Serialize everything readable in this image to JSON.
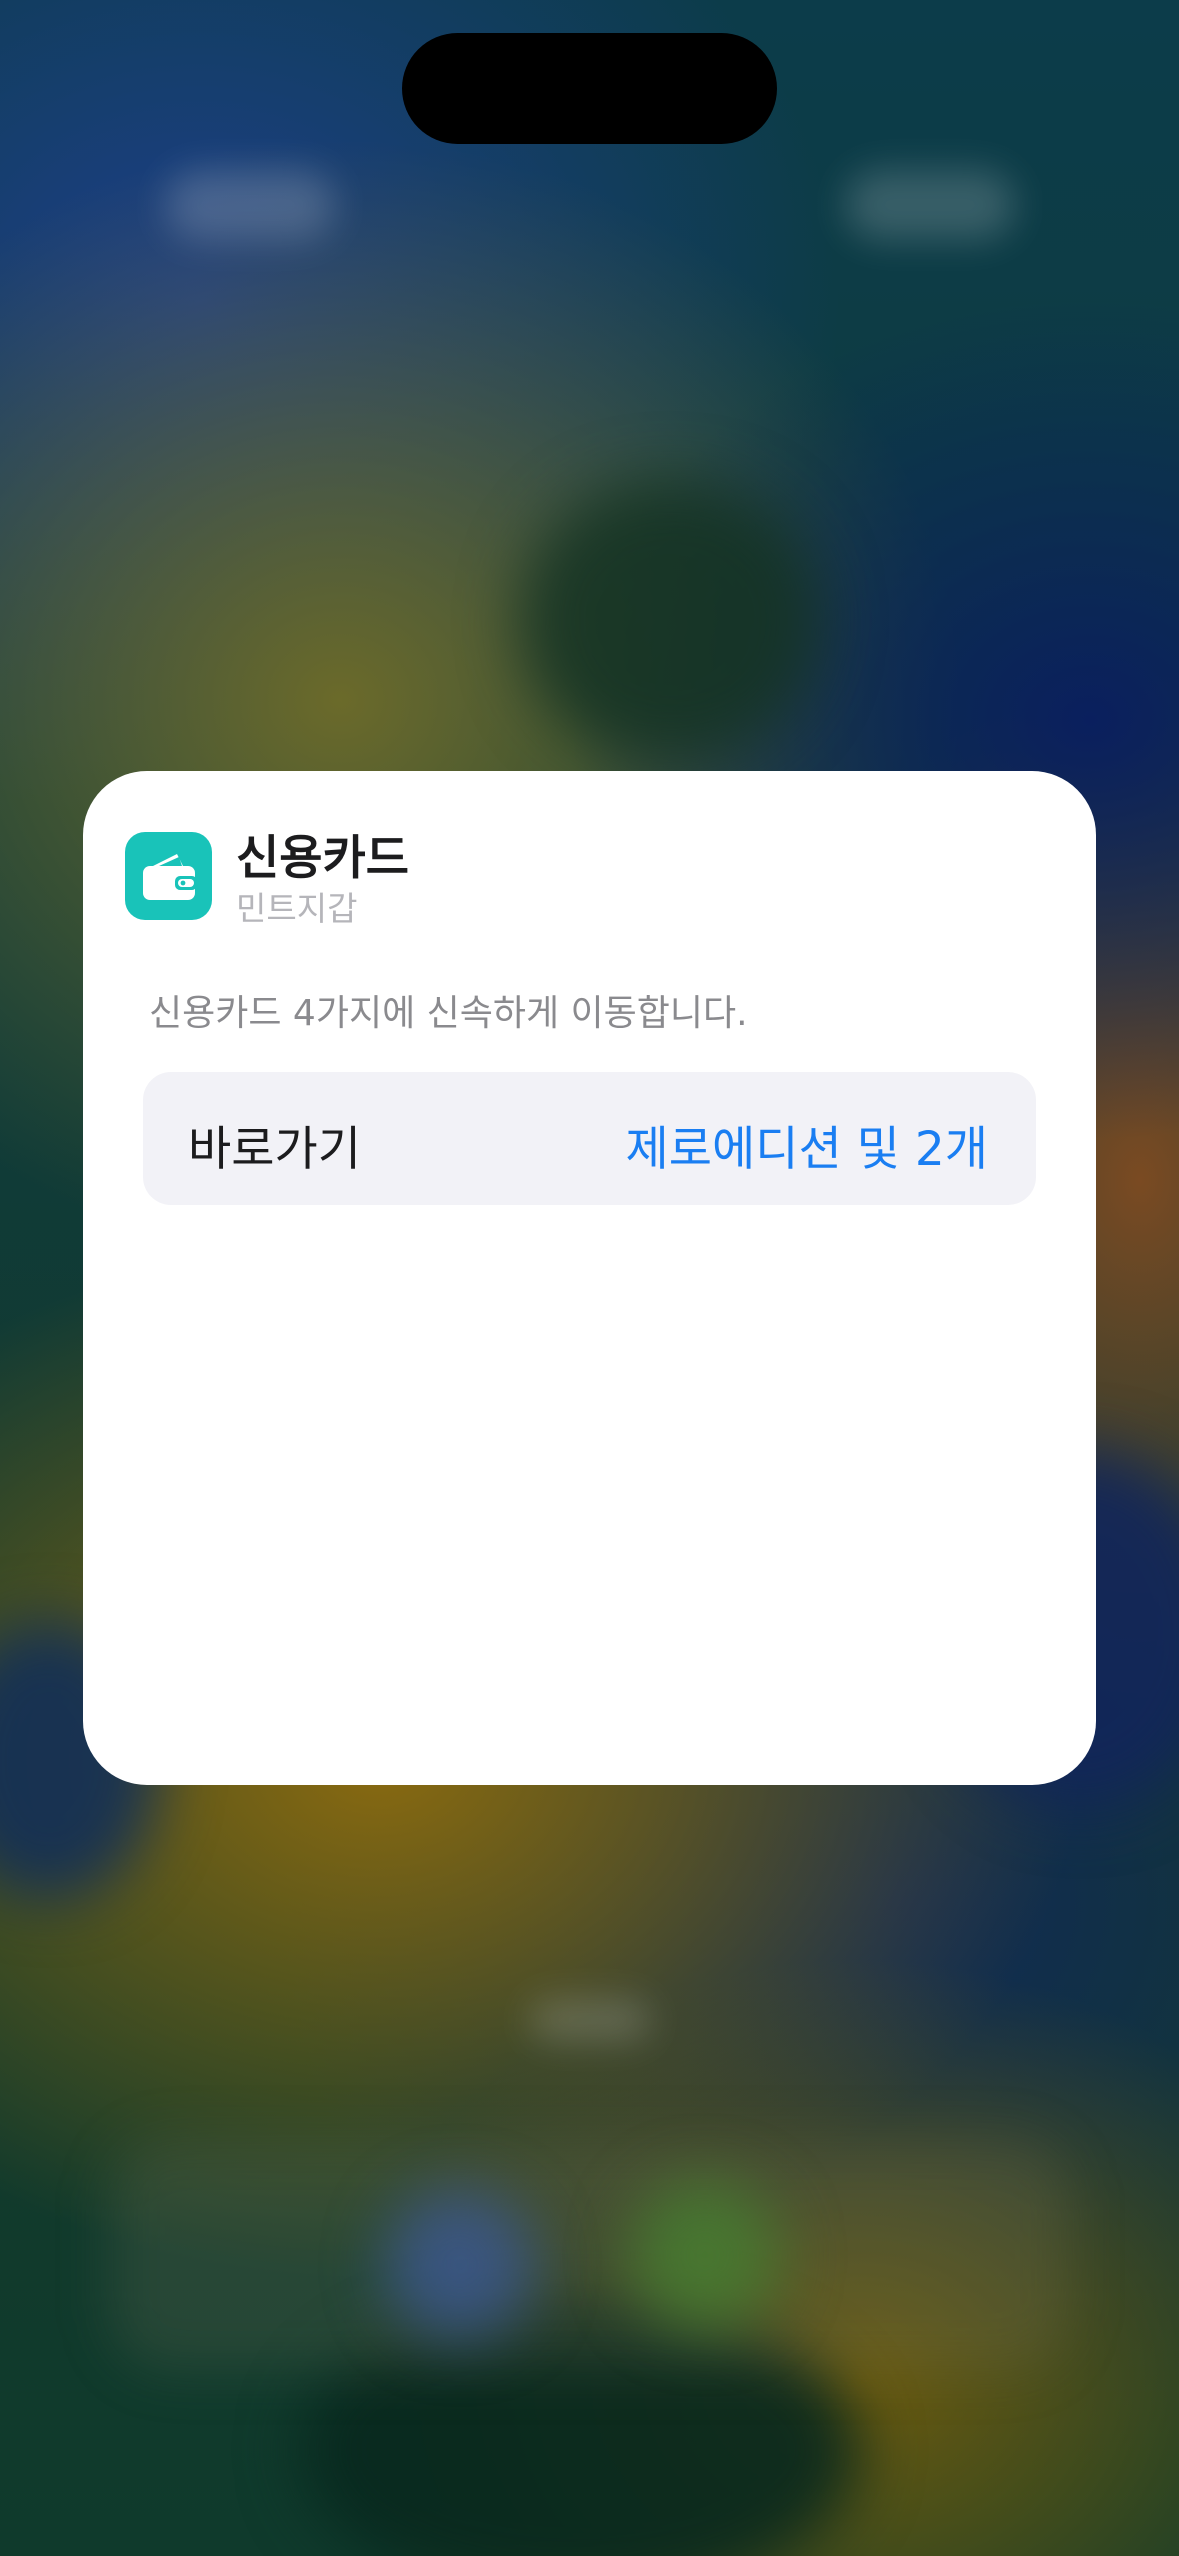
{
  "widget": {
    "app_title": "신용카드",
    "app_subtitle": "민트지갑",
    "app_icon": "wallet-icon",
    "description": "신용카드 4가지에 신속하게 이동합니다.",
    "row": {
      "label": "바로가기",
      "value": "제로에디션 및 2개"
    }
  },
  "colors": {
    "app_icon_background": "#19c3b9",
    "value_text": "#1a7ef2",
    "card_background": "#ffffff",
    "row_background": "#f2f2f7"
  }
}
